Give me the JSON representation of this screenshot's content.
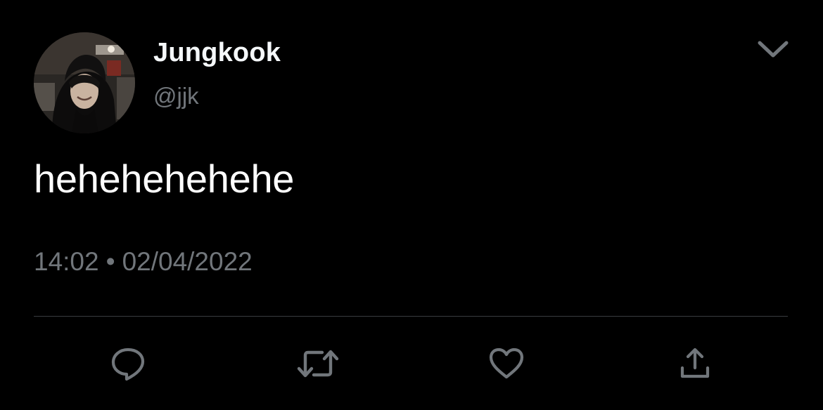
{
  "tweet": {
    "author": {
      "display_name": "Jungkook",
      "handle": "@jjk",
      "avatar_icon": "profile-photo"
    },
    "text": "hehehehehehe",
    "time": "14:02",
    "separator": "•",
    "date": "02/04/2022"
  },
  "actions": [
    {
      "name": "reply",
      "icon": "reply-icon"
    },
    {
      "name": "retweet",
      "icon": "retweet-icon"
    },
    {
      "name": "like",
      "icon": "heart-icon"
    },
    {
      "name": "share",
      "icon": "share-icon"
    }
  ],
  "colors": {
    "background": "#000000",
    "primary_text": "#ffffff",
    "secondary_text": "#71767b",
    "icon": "#71767b",
    "divider": "#3a3d40"
  }
}
